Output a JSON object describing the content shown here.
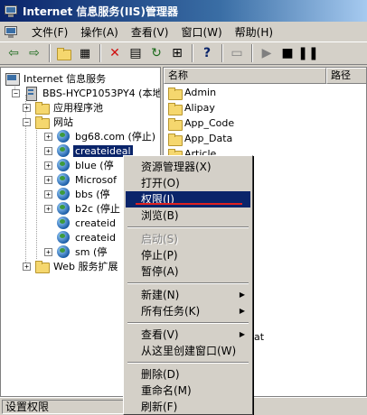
{
  "window": {
    "title": "Internet 信息服务(IIS)管理器"
  },
  "menu": [
    "文件(F)",
    "操作(A)",
    "查看(V)",
    "窗口(W)",
    "帮助(H)"
  ],
  "toolbar_icons": [
    "back-icon",
    "forward-icon",
    "up-folder-icon",
    "show-tree-icon",
    "delete-icon",
    "properties-icon",
    "refresh-icon",
    "export-icon",
    "help-icon",
    "computer-icon",
    "play-icon",
    "stop-icon",
    "pause-icon"
  ],
  "tree": {
    "root": "Internet 信息服务",
    "server": "BBS-HYCP1053PY4 (本地计",
    "app_pools": "应用程序池",
    "websites": "网站",
    "sites": [
      "bg68.com (停止)",
      "createideal",
      "blue  (停",
      "Microsof",
      "bbs  (停",
      "b2c (停止",
      "createid",
      "createid",
      "sm   (停"
    ],
    "web_ext": "Web 服务扩展"
  },
  "list": {
    "columns": [
      "名称",
      "路径"
    ],
    "rows": [
      "Admin",
      "Alipay",
      "App_Code",
      "App_Data",
      "Article"
    ],
    "partial_text": "at"
  },
  "context_menu": {
    "items": [
      {
        "label": "资源管理器(X)",
        "state": "normal"
      },
      {
        "label": "打开(O)",
        "state": "normal"
      },
      {
        "label": "权限(I)",
        "state": "highlight"
      },
      {
        "label": "浏览(B)",
        "state": "normal"
      },
      {
        "label": "启动(S)",
        "state": "disabled"
      },
      {
        "label": "停止(P)",
        "state": "normal"
      },
      {
        "label": "暂停(A)",
        "state": "normal"
      },
      {
        "label": "新建(N)",
        "state": "submenu"
      },
      {
        "label": "所有任务(K)",
        "state": "submenu"
      },
      {
        "label": "查看(V)",
        "state": "submenu"
      },
      {
        "label": "从这里创建窗口(W)",
        "state": "normal"
      },
      {
        "label": "删除(D)",
        "state": "normal"
      },
      {
        "label": "重命名(M)",
        "state": "normal"
      },
      {
        "label": "刷新(F)",
        "state": "normal"
      }
    ]
  },
  "status": "设置权限",
  "colors": {
    "selection": "#0a246a",
    "annotation": "#e02020"
  }
}
